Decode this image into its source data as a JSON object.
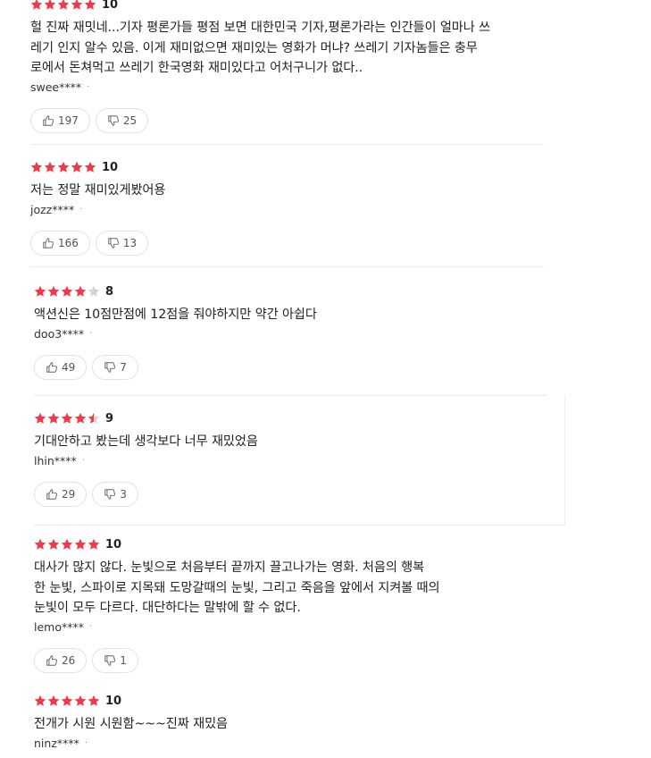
{
  "reviews": [
    {
      "rating": 10,
      "stars": 5,
      "lines": [
        "헐 진짜 재밋네...기자 평론가들 평점 보면 대한민국 기자,평론가라는 인간들이 얼마나 쓰",
        "레기 인지 알수 있음. 이게 재미없으면 재미있는 영화가 머냐? 쓰레기 기자놈들은 충무",
        "로에서 돈쳐먹고 쓰레기 한국영화 재미있다고 어처구니가 없다.."
      ],
      "author": "swee****",
      "likes": "197",
      "dislikes": "25"
    },
    {
      "rating": 10,
      "stars": 5,
      "lines": [
        "저는 정말 재미있게봤어용"
      ],
      "author": "jozz****",
      "likes": "166",
      "dislikes": "13"
    },
    {
      "rating": 8,
      "stars": 4,
      "lines": [
        "액션신은 10점만점에 12점을 줘야하지만 약간 아쉽다"
      ],
      "author": "doo3****",
      "likes": "49",
      "dislikes": "7"
    },
    {
      "rating": 9,
      "stars": 4.5,
      "lines": [
        "기대안하고 봤는데 생각보다 너무 재밌었음"
      ],
      "author": "lhin****",
      "likes": "29",
      "dislikes": "3"
    },
    {
      "rating": 10,
      "stars": 5,
      "lines": [
        "대사가 많지 않다. 눈빛으로 처음부터 끝까지 끌고나가는 영화. 처음의 행복",
        "한 눈빛, 스파이로 지목돼 도망갈때의 눈빛, 그리고  죽음을 앞에서 지켜볼 때의",
        "눈빛이 모두 다르다. 대단하다는 말밖에 할 수 없다."
      ],
      "author": "lemo****",
      "likes": "26",
      "dislikes": "1"
    },
    {
      "rating": 10,
      "stars": 5,
      "lines": [
        "전개가 시원 시원함~~~진짜 재밌음"
      ],
      "author": "ninz****"
    }
  ],
  "colors": {
    "star_on": "#f0394a",
    "star_off": "#d4d4d4",
    "text": "#222222",
    "meta": "#333333"
  },
  "icons": {
    "like": "thumbs-up-icon",
    "dislike": "thumbs-down-icon",
    "star": "star-icon"
  }
}
